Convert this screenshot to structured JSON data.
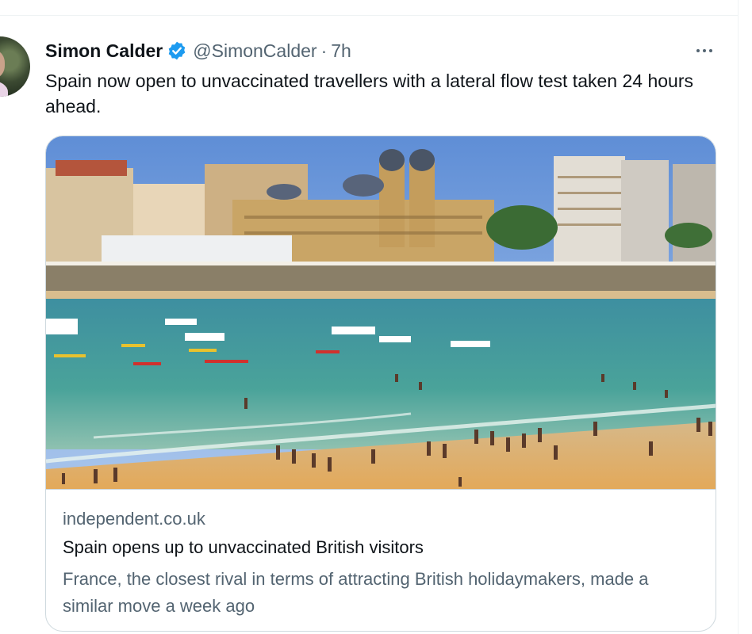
{
  "tweet": {
    "author_name": "Simon Calder",
    "handle": "@SimonCalder",
    "separator": "·",
    "time": "7h",
    "text": "Spain now open to unvaccinated travellers with a lateral flow test taken 24 hours ahead.",
    "more_icon": "more-horizontal-icon",
    "verified_icon": "verified-badge-icon",
    "verified_color": "#1d9bf0"
  },
  "card": {
    "image_alt": "Crowded beach at San Sebastián with boats in the bay and historic buildings behind",
    "domain": "independent.co.uk",
    "title": "Spain opens up to unvaccinated British visitors",
    "description": "France, the closest rival in terms of attracting British holidaymakers, made a similar move a week ago"
  },
  "colors": {
    "text_primary": "#0f1419",
    "text_secondary": "#536471",
    "border": "#cfd9de"
  }
}
